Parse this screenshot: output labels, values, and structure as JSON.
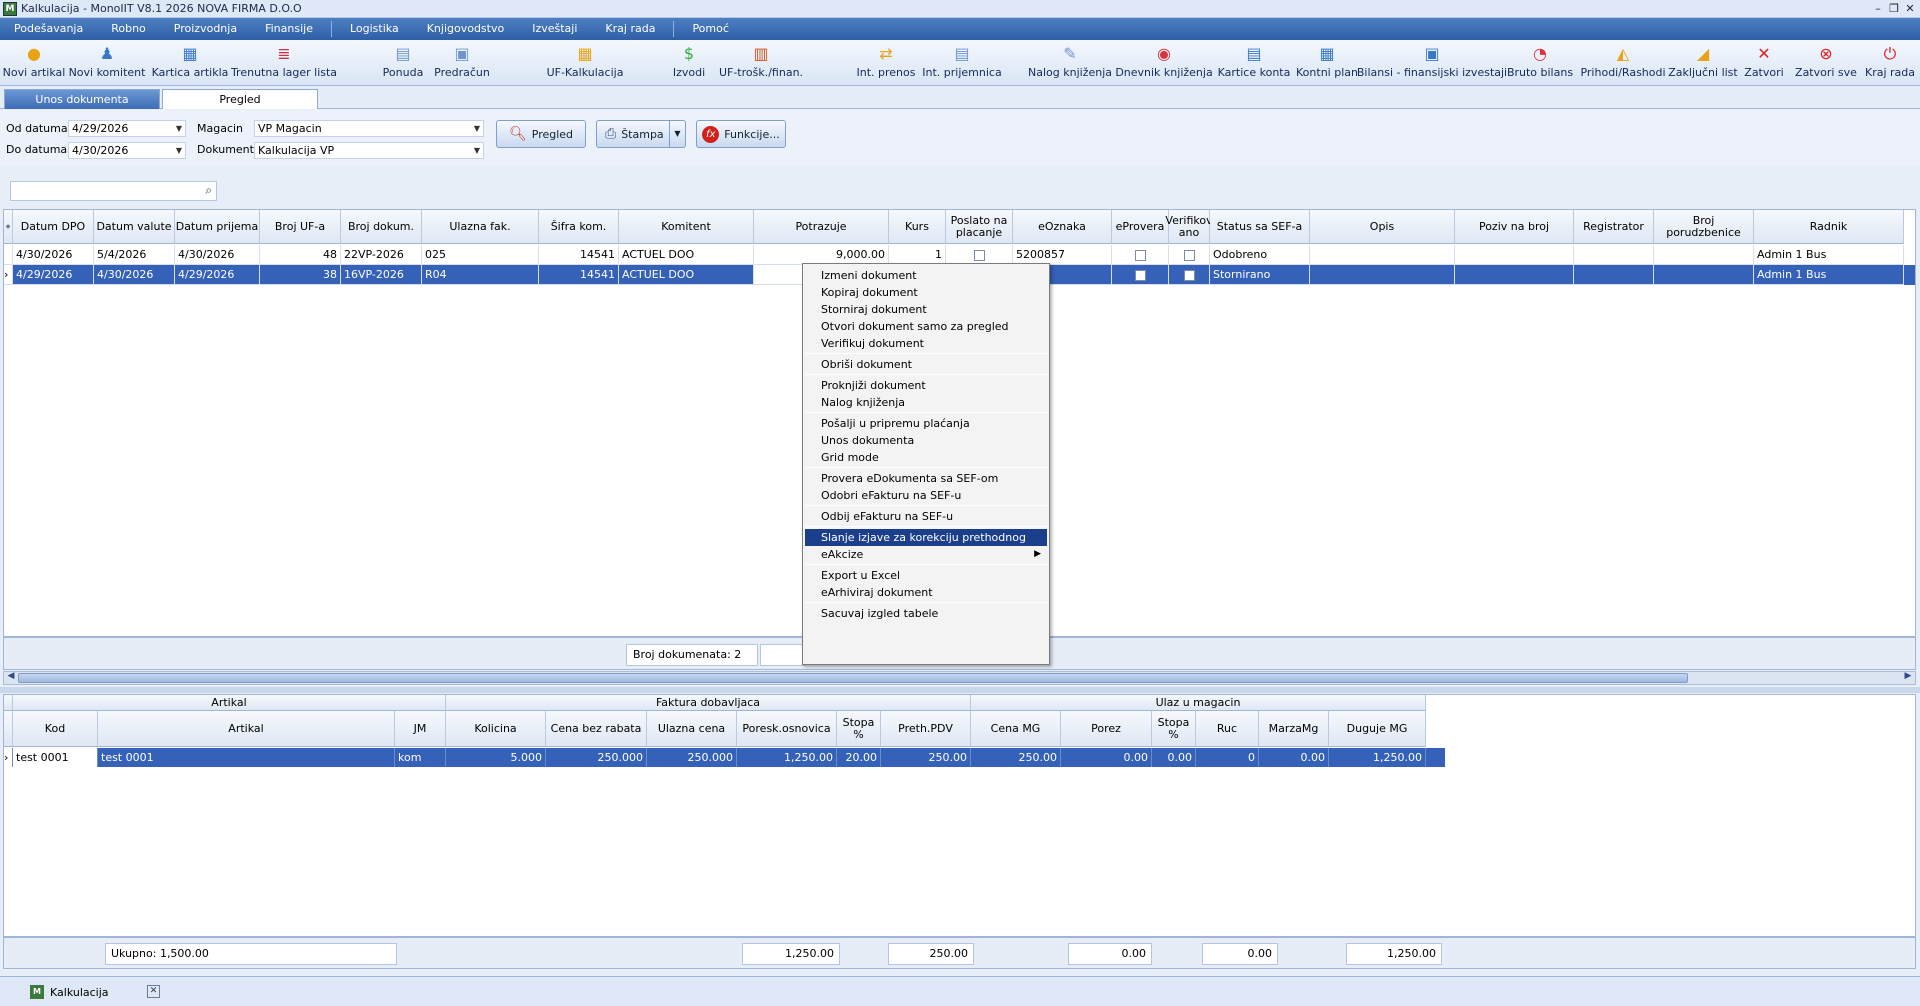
{
  "window": {
    "title": "Kalkulacija - MonoIIT V8.1 2026 NOVA FIRMA D.O.O",
    "icon": "monoit-app-icon"
  },
  "menu": [
    "Podešavanja",
    "Robno",
    "Proizvodnja",
    "Finansije",
    "Logistika",
    "Knjigovodstvo",
    "Izveštaji",
    "Kraj rada",
    "Pomoć"
  ],
  "toolbar": [
    {
      "label": "Novi artikal",
      "icon": "new-item-icon",
      "color": "#e8a317"
    },
    {
      "label": "Novi komitent",
      "icon": "new-partner-icon",
      "color": "#3a78c8"
    },
    {
      "label": "Kartica artikla",
      "icon": "item-card-icon",
      "color": "#3a78c8"
    },
    {
      "label": "Trenutna lager lista",
      "icon": "stock-list-icon",
      "color": "#c8344a"
    },
    {
      "label": "Ponuda",
      "icon": "offer-icon",
      "color": "#6f95cf"
    },
    {
      "label": "Predračun",
      "icon": "proforma-icon",
      "color": "#6f95cf"
    },
    {
      "label": "UF-Kalkulacija",
      "icon": "calculation-icon",
      "color": "#e8a317"
    },
    {
      "label": "Izvodi",
      "icon": "statements-icon",
      "color": "#3aa845"
    },
    {
      "label": "UF-trošk./finan.",
      "icon": "costs-icon",
      "color": "#d8541a"
    },
    {
      "label": "Int. prenos",
      "icon": "transfer-icon",
      "color": "#e8a317"
    },
    {
      "label": "Int. prijemnica",
      "icon": "receipt-icon",
      "color": "#6f95cf"
    },
    {
      "label": "Nalog knjiženja",
      "icon": "posting-order-icon",
      "color": "#6f95cf"
    },
    {
      "label": "Dnevnik knjiženja",
      "icon": "journal-icon",
      "color": "#d8343a"
    },
    {
      "label": "Kartice konta",
      "icon": "account-cards-icon",
      "color": "#3a78c8"
    },
    {
      "label": "Kontni plan",
      "icon": "chart-of-accounts-icon",
      "color": "#3a78c8"
    },
    {
      "label": "Bilansi - finansijski izvestaji",
      "icon": "balance-icon",
      "color": "#3a78c8"
    },
    {
      "label": "Bruto bilans",
      "icon": "gross-balance-icon",
      "color": "#d8343a"
    },
    {
      "label": "Prihodi/Rashodi",
      "icon": "income-expense-icon",
      "color": "#e8a317"
    },
    {
      "label": "Zaključni list",
      "icon": "closing-sheet-icon",
      "color": "#e8a317"
    },
    {
      "label": "Zatvori",
      "icon": "close-icon",
      "color": "#e02020"
    },
    {
      "label": "Zatvori sve",
      "icon": "close-all-icon",
      "color": "#e02020"
    },
    {
      "label": "Kraj rada",
      "icon": "exit-icon",
      "color": "#e02020"
    }
  ],
  "tabs": [
    "Unos dokumenta",
    "Pregled"
  ],
  "filter": {
    "od_label": "Od datuma",
    "od_value": "4/29/2026",
    "do_label": "Do datuma",
    "do_value": "4/30/2026",
    "magacin_label": "Magacin",
    "magacin_value": "VP Magacin",
    "dokument_label": "Dokument",
    "dokument_value": "Kalkulacija VP",
    "btn_pregled": "Pregled",
    "btn_stampa": "Štampa",
    "btn_funkcije": "Funkcije..."
  },
  "search": {
    "placeholder": ""
  },
  "grid": {
    "headers": [
      "Datum DPO",
      "Datum valute",
      "Datum prijema",
      "Broj UF-a",
      "Broj dokum.",
      "Ulazna fak.",
      "Šifra kom.",
      "Komitent",
      "Potrazuje",
      "Kurs",
      "Poslato na placanje",
      "eOznaka",
      "eProvera",
      "Verifikov ano",
      "Status sa SEF-a",
      "Opis",
      "Poziv na broj",
      "Registrator",
      "Broj porudzbenice",
      "Radnik"
    ],
    "rows": [
      {
        "datum_dpo": "4/30/2026",
        "datum_valute": "5/4/2026",
        "datum_prijema": "4/30/2026",
        "broj_uf": "48",
        "broj_dok": "22VP-2026",
        "ulazna_fak": "025",
        "sifra_kom": "14541",
        "komitent": "ACTUEL DOO",
        "potrazuje": "9,000.00",
        "kurs": "1",
        "eoznaka": "5200857",
        "status": "Odobreno",
        "radnik": "Admin 1 Bus"
      },
      {
        "datum_dpo": "4/29/2026",
        "datum_valute": "4/30/2026",
        "datum_prijema": "4/29/2026",
        "broj_uf": "38",
        "broj_dok": "16VP-2026",
        "ulazna_fak": "R04",
        "sifra_kom": "14541",
        "komitent": "ACTUEL DOO",
        "potrazuje": "",
        "kurs": "",
        "eoznaka": "",
        "status": "Stornirano",
        "radnik": "Admin 1 Bus"
      }
    ],
    "count_label": "Broj dokumenata: 2"
  },
  "context_menu": {
    "groups": [
      [
        "Izmeni dokument",
        "Kopiraj dokument",
        "Storniraj dokument",
        "Otvori dokument samo za pregled",
        "Verifikuj dokument"
      ],
      [
        "Obriši dokument"
      ],
      [
        "Proknjiži dokument",
        "Nalog knjiženja"
      ],
      [
        "Pošalji u pripremu plaćanja",
        "Unos dokumenta",
        "Grid mode"
      ],
      [
        "Provera eDokumenta sa SEF-om",
        "Odobri eFakturu na SEF-u"
      ],
      [
        "Odbij eFakturu na SEF-u"
      ],
      [
        "Slanje izjave za korekciju prethodnog PDVa",
        "eAkcize"
      ],
      [
        "Export u Excel",
        "eArhiviraj dokument"
      ],
      [
        "Sacuvaj izgled tabele"
      ]
    ],
    "highlighted": "Slanje izjave za korekciju prethodnog PDVa",
    "submenu_item": "eAkcize"
  },
  "detail": {
    "band_headers": [
      "Artikal",
      "Faktura dobavljaca",
      "Ulaz u magacin"
    ],
    "headers": [
      "Kod",
      "Artikal",
      "JM",
      "Kolicina",
      "Cena bez rabata",
      "Ulazna cena",
      "Poresk.osnovica",
      "Stopa %",
      "Preth.PDV",
      "Cena MG",
      "Porez",
      "Stopa %",
      "Ruc",
      "MarzaMg",
      "Duguje MG"
    ],
    "row": [
      "test 0001",
      "test 0001",
      "kom",
      "5.000",
      "250.000",
      "250.000",
      "1,250.00",
      "20.00",
      "250.00",
      "250.00",
      "0.00",
      "0.00",
      "0",
      "0.00",
      "1,250.00"
    ],
    "footer": {
      "ukupno": "Ukupno: 1,500.00",
      "poresk": "1,250.00",
      "pdv": "250.00",
      "porez": "0.00",
      "ruc": "0.00",
      "duguje": "1,250.00"
    }
  },
  "status_tab": {
    "label": "Kalkulacija"
  }
}
